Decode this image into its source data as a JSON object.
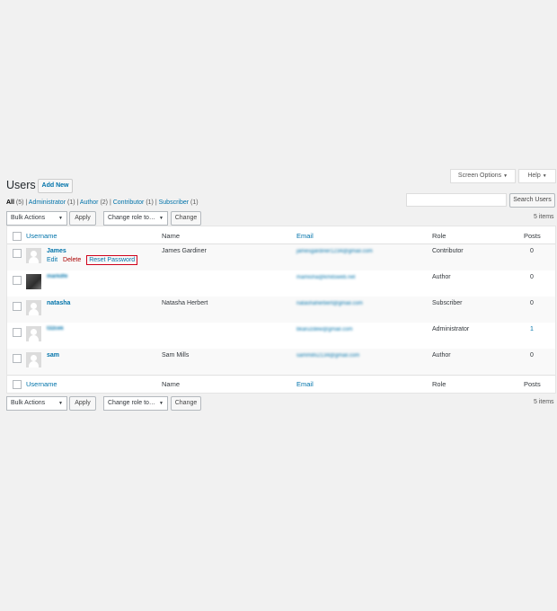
{
  "header": {
    "screen_options": "Screen Options",
    "help": "Help",
    "title": "Users",
    "add_new": "Add New"
  },
  "filters": {
    "all": "All",
    "all_count": "(5)",
    "administrator": "Administrator",
    "administrator_count": "(1)",
    "author": "Author",
    "author_count": "(2)",
    "contributor": "Contributor",
    "contributor_count": "(1)",
    "subscriber": "Subscriber",
    "subscriber_count": "(1)"
  },
  "search": {
    "button": "Search Users",
    "value": ""
  },
  "toolbar": {
    "bulk_actions": "Bulk Actions",
    "apply": "Apply",
    "change_role": "Change role to…",
    "change": "Change",
    "items_count": "5 items"
  },
  "columns": {
    "username": "Username",
    "name": "Name",
    "email": "Email",
    "role": "Role",
    "posts": "Posts"
  },
  "rows": [
    {
      "username": "James",
      "name": "James Gardiner",
      "email": "jamesgardiner1234@gmail.com",
      "role": "Contributor",
      "posts": "0"
    },
    {
      "username": "markdfe",
      "name": "",
      "email": "mamisha@kmitsweb.net",
      "role": "Author",
      "posts": "0"
    },
    {
      "username": "natasha",
      "name": "Natasha Herbert",
      "email": "natashaherbert@gmail.com",
      "role": "Subscriber",
      "posts": "0"
    },
    {
      "username": "t32cek",
      "name": "",
      "email": "bkaruzdew@gmail.com",
      "role": "Administrator",
      "posts": "1"
    },
    {
      "username": "sam",
      "name": "Sam Mills",
      "email": "sammills2134@gmail.com",
      "role": "Author",
      "posts": "0"
    }
  ],
  "row_actions": {
    "edit": "Edit",
    "delete": "Delete",
    "reset_password": "Reset Password"
  },
  "colors": {
    "link": "#0073aa",
    "delete": "#aa0000",
    "highlight_box": "#d0021b",
    "background": "#f1f1f1"
  }
}
